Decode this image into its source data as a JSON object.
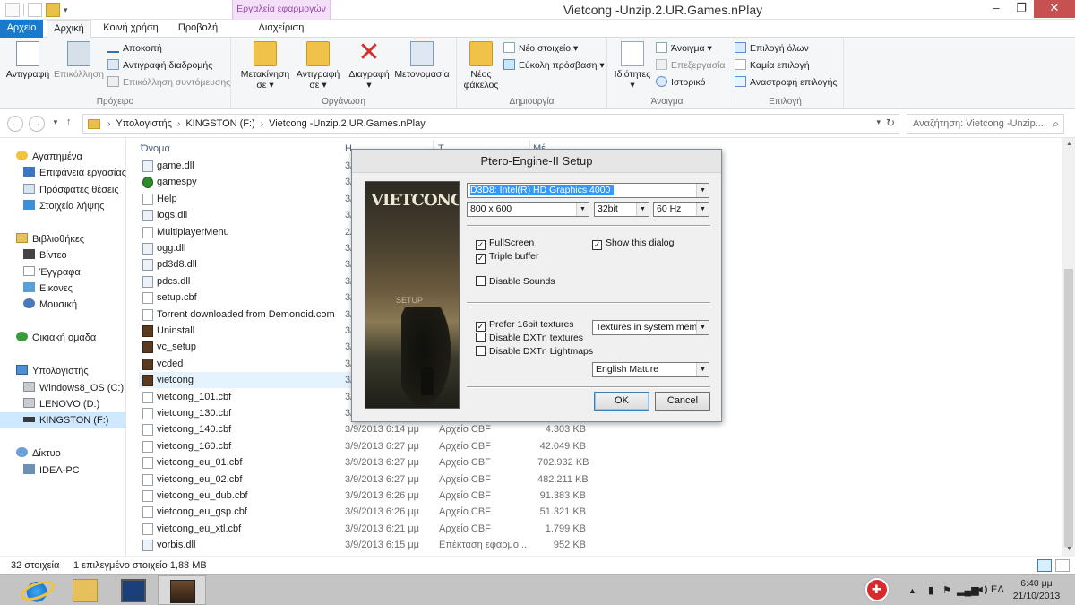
{
  "window": {
    "title": "Vietcong -Unzip.2.UR.Games.nPlay",
    "context_group_title": "Εργαλεία εφαρμογών",
    "controls": {
      "minimize": "–",
      "maximize": "❐",
      "close": "✕"
    }
  },
  "ribbon_tabs": {
    "file": "Αρχείο",
    "home": "Αρχική",
    "share": "Κοινή χρήση",
    "view": "Προβολή",
    "manage": "Διαχείριση"
  },
  "ribbon": {
    "clipboard": {
      "copy": "Αντιγραφή",
      "paste": "Επικόλληση",
      "cut": "Αποκοπή",
      "copy_path": "Αντιγραφή διαδρομής",
      "paste_shortcut": "Επικόλληση συντόμευσης",
      "label": "Πρόχειρο"
    },
    "organize": {
      "move_to_1": "Μετακίνηση",
      "move_to_2": "σε ▾",
      "copy_to_1": "Αντιγραφή",
      "copy_to_2": "σε ▾",
      "delete_1": "Διαγραφή",
      "delete_2": "▾",
      "rename": "Μετονομασία",
      "label": "Οργάνωση"
    },
    "new": {
      "new_folder_1": "Νέος",
      "new_folder_2": "φάκελος",
      "new_item": "Νέο στοιχείο ▾",
      "easy_access": "Εύκολη πρόσβαση ▾",
      "label": "Δημιουργία"
    },
    "open": {
      "properties_1": "Ιδιότητες",
      "properties_2": "▾",
      "open": "Άνοιγμα ▾",
      "edit": "Επεξεργασία",
      "history": "Ιστορικό",
      "label": "Άνοιγμα"
    },
    "select": {
      "select_all": "Επιλογή όλων",
      "select_none": "Καμία επιλογή",
      "invert": "Αναστροφή επιλογής",
      "label": "Επιλογή"
    }
  },
  "address": {
    "crumbs": [
      "Υπολογιστής",
      "KINGSTON (F:)",
      "Vietcong -Unzip.2.UR.Games.nPlay"
    ],
    "search_placeholder": "Αναζήτηση: Vietcong -Unzip...."
  },
  "nav_pane": {
    "favorites": "Αγαπημένα",
    "desktop": "Επιφάνεια εργασίας",
    "recent": "Πρόσφατες θέσεις",
    "downloads": "Στοιχεία λήψης",
    "libraries": "Βιβλιοθήκες",
    "videos": "Βίντεο",
    "documents": "Έγγραφα",
    "pictures": "Εικόνες",
    "music": "Μουσική",
    "homegroup": "Οικιακή ομάδα",
    "computer": "Υπολογιστής",
    "drive_c": "Windows8_OS (C:)",
    "drive_d": "LENOVO (D:)",
    "drive_f": "KINGSTON (F:)",
    "network": "Δίκτυο",
    "idea_pc": "IDEA-PC"
  },
  "file_list": {
    "col_name": "Όνομα",
    "col_date_partial": "Η",
    "col_type_partial": "Τ",
    "col_size_partial": "Μέ",
    "files": [
      {
        "name": "game.dll",
        "date": "3/",
        "type": "",
        "size": "",
        "icon": "dll-gear-icon"
      },
      {
        "name": "gamespy",
        "date": "3/",
        "type": "",
        "size": "",
        "icon": "gamespy-app-icon"
      },
      {
        "name": "Help",
        "date": "3/",
        "type": "",
        "size": "",
        "icon": "help-file-icon"
      },
      {
        "name": "logs.dll",
        "date": "3/",
        "type": "",
        "size": "",
        "icon": "dll-gear-icon"
      },
      {
        "name": "MultiplayerMenu",
        "date": "2/",
        "type": "",
        "size": "",
        "icon": "file-icon"
      },
      {
        "name": "ogg.dll",
        "date": "3/",
        "type": "",
        "size": "",
        "icon": "dll-gear-icon"
      },
      {
        "name": "pd3d8.dll",
        "date": "3/",
        "type": "",
        "size": "",
        "icon": "dll-gear-icon"
      },
      {
        "name": "pdcs.dll",
        "date": "3/",
        "type": "",
        "size": "",
        "icon": "dll-gear-icon"
      },
      {
        "name": "setup.cbf",
        "date": "3/",
        "type": "",
        "size": "",
        "icon": "file-icon"
      },
      {
        "name": "Torrent downloaded from Demonoid.com",
        "date": "3/",
        "type": "",
        "size": "",
        "icon": "text-file-icon"
      },
      {
        "name": "Uninstall",
        "date": "3/",
        "type": "",
        "size": "",
        "icon": "game-app-icon"
      },
      {
        "name": "vc_setup",
        "date": "3/",
        "type": "",
        "size": "",
        "icon": "setup-app-icon"
      },
      {
        "name": "vcded",
        "date": "3/",
        "type": "",
        "size": "",
        "icon": "game-app-icon"
      },
      {
        "name": "vietcong",
        "date": "3/",
        "type": "",
        "size": "",
        "icon": "game-app-icon"
      },
      {
        "name": "vietcong_101.cbf",
        "date": "3/",
        "type": "",
        "size": "",
        "icon": "file-icon"
      },
      {
        "name": "vietcong_130.cbf",
        "date": "3/",
        "type": "",
        "size": "",
        "icon": "file-icon"
      },
      {
        "name": "vietcong_140.cbf",
        "date": "3/9/2013 6:14 μμ",
        "type": "Αρχείο CBF",
        "size": "4.303 KB",
        "icon": "file-icon"
      },
      {
        "name": "vietcong_160.cbf",
        "date": "3/9/2013 6:27 μμ",
        "type": "Αρχείο CBF",
        "size": "42.049 KB",
        "icon": "file-icon"
      },
      {
        "name": "vietcong_eu_01.cbf",
        "date": "3/9/2013 6:27 μμ",
        "type": "Αρχείο CBF",
        "size": "702.932 KB",
        "icon": "file-icon"
      },
      {
        "name": "vietcong_eu_02.cbf",
        "date": "3/9/2013 6:27 μμ",
        "type": "Αρχείο CBF",
        "size": "482.211 KB",
        "icon": "file-icon"
      },
      {
        "name": "vietcong_eu_dub.cbf",
        "date": "3/9/2013 6:26 μμ",
        "type": "Αρχείο CBF",
        "size": "91.383 KB",
        "icon": "file-icon"
      },
      {
        "name": "vietcong_eu_gsp.cbf",
        "date": "3/9/2013 6:26 μμ",
        "type": "Αρχείο CBF",
        "size": "51.321 KB",
        "icon": "file-icon"
      },
      {
        "name": "vietcong_eu_xtl.cbf",
        "date": "3/9/2013 6:21 μμ",
        "type": "Αρχείο CBF",
        "size": "1.799 KB",
        "icon": "file-icon"
      },
      {
        "name": "vorbis.dll",
        "date": "3/9/2013 6:15 μμ",
        "type": "Επέκταση εφαρμο...",
        "size": "952 KB",
        "icon": "dll-gear-icon"
      }
    ]
  },
  "status": {
    "items": "32 στοιχεία",
    "selected": "1 επιλεγμένο στοιχείο  1,88 MB"
  },
  "dialog": {
    "title": "Ptero-Engine-II Setup",
    "banner_title": "VIETCONG",
    "banner_setup": "SETUP",
    "device": "D3D8: Intel(R) HD Graphics 4000",
    "resolution": "800 x 600",
    "depth": "32bit",
    "refresh": "60 Hz",
    "checks": {
      "fullscreen": {
        "label": "FullScreen",
        "checked": true
      },
      "show_dialog": {
        "label": "Show this dialog",
        "checked": true
      },
      "triple_buffer": {
        "label": "Triple buffer",
        "checked": true
      },
      "disable_sounds": {
        "label": "Disable Sounds",
        "checked": false
      },
      "prefer16": {
        "label": "Prefer 16bit textures",
        "checked": true
      },
      "disable_dxtn_tex": {
        "label": "Disable DXTn textures",
        "checked": false
      },
      "disable_dxtn_light": {
        "label": "Disable DXTn Lightmaps",
        "checked": false
      }
    },
    "texture_mem": "Textures in system memory",
    "language": "English Mature",
    "ok": "OK",
    "cancel": "Cancel"
  },
  "taskbar": {
    "lang": "ΕΛ",
    "time": "6:40 μμ",
    "date": "21/10/2013"
  },
  "colors": {
    "file_tab": "#1979ca",
    "context_tab": "#f3dff7",
    "selection": "#cde8ff",
    "close_button": "#c75050"
  }
}
